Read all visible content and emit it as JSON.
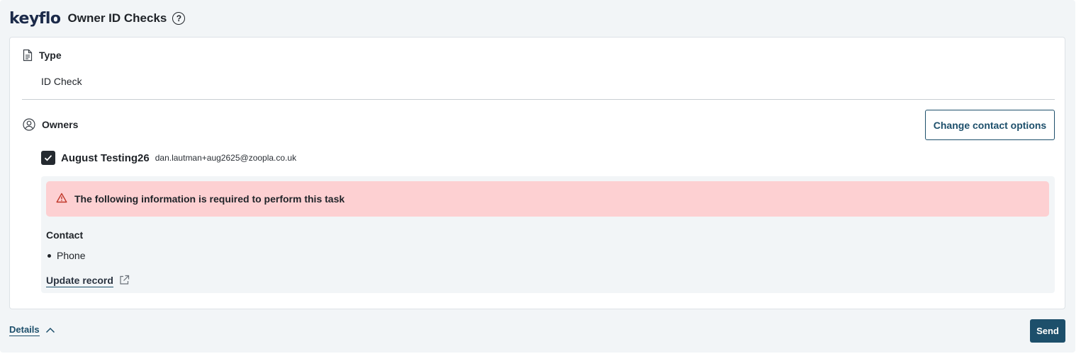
{
  "header": {
    "logo": "keyflo",
    "title": "Owner ID Checks",
    "help_icon": "question-circle-icon",
    "help_glyph": "?"
  },
  "type_section": {
    "icon": "document-icon",
    "heading": "Type",
    "value": "ID Check"
  },
  "owners_section": {
    "icon": "user-circle-icon",
    "heading": "Owners",
    "change_button_label": "Change contact options",
    "owner": {
      "checked": true,
      "name": "August Testing26",
      "email": "dan.lautman+aug2625@zoopla.co.uk"
    },
    "requirements": {
      "alert_icon": "warning-triangle-icon",
      "alert_text": "The following information is required to perform this task",
      "contact_label": "Contact",
      "items": [
        "Phone"
      ],
      "update_link_label": "Update record",
      "update_link_icon": "external-link-icon"
    }
  },
  "footer": {
    "details_label": "Details",
    "details_icon": "chevron-up-icon",
    "send_label": "Send"
  },
  "colors": {
    "brand": "#1b2a49",
    "primary": "#1d4f6b",
    "alert_bg": "#fdd0d2",
    "alert_icon": "#c0392b",
    "panel_bg": "#f2f5f7"
  }
}
